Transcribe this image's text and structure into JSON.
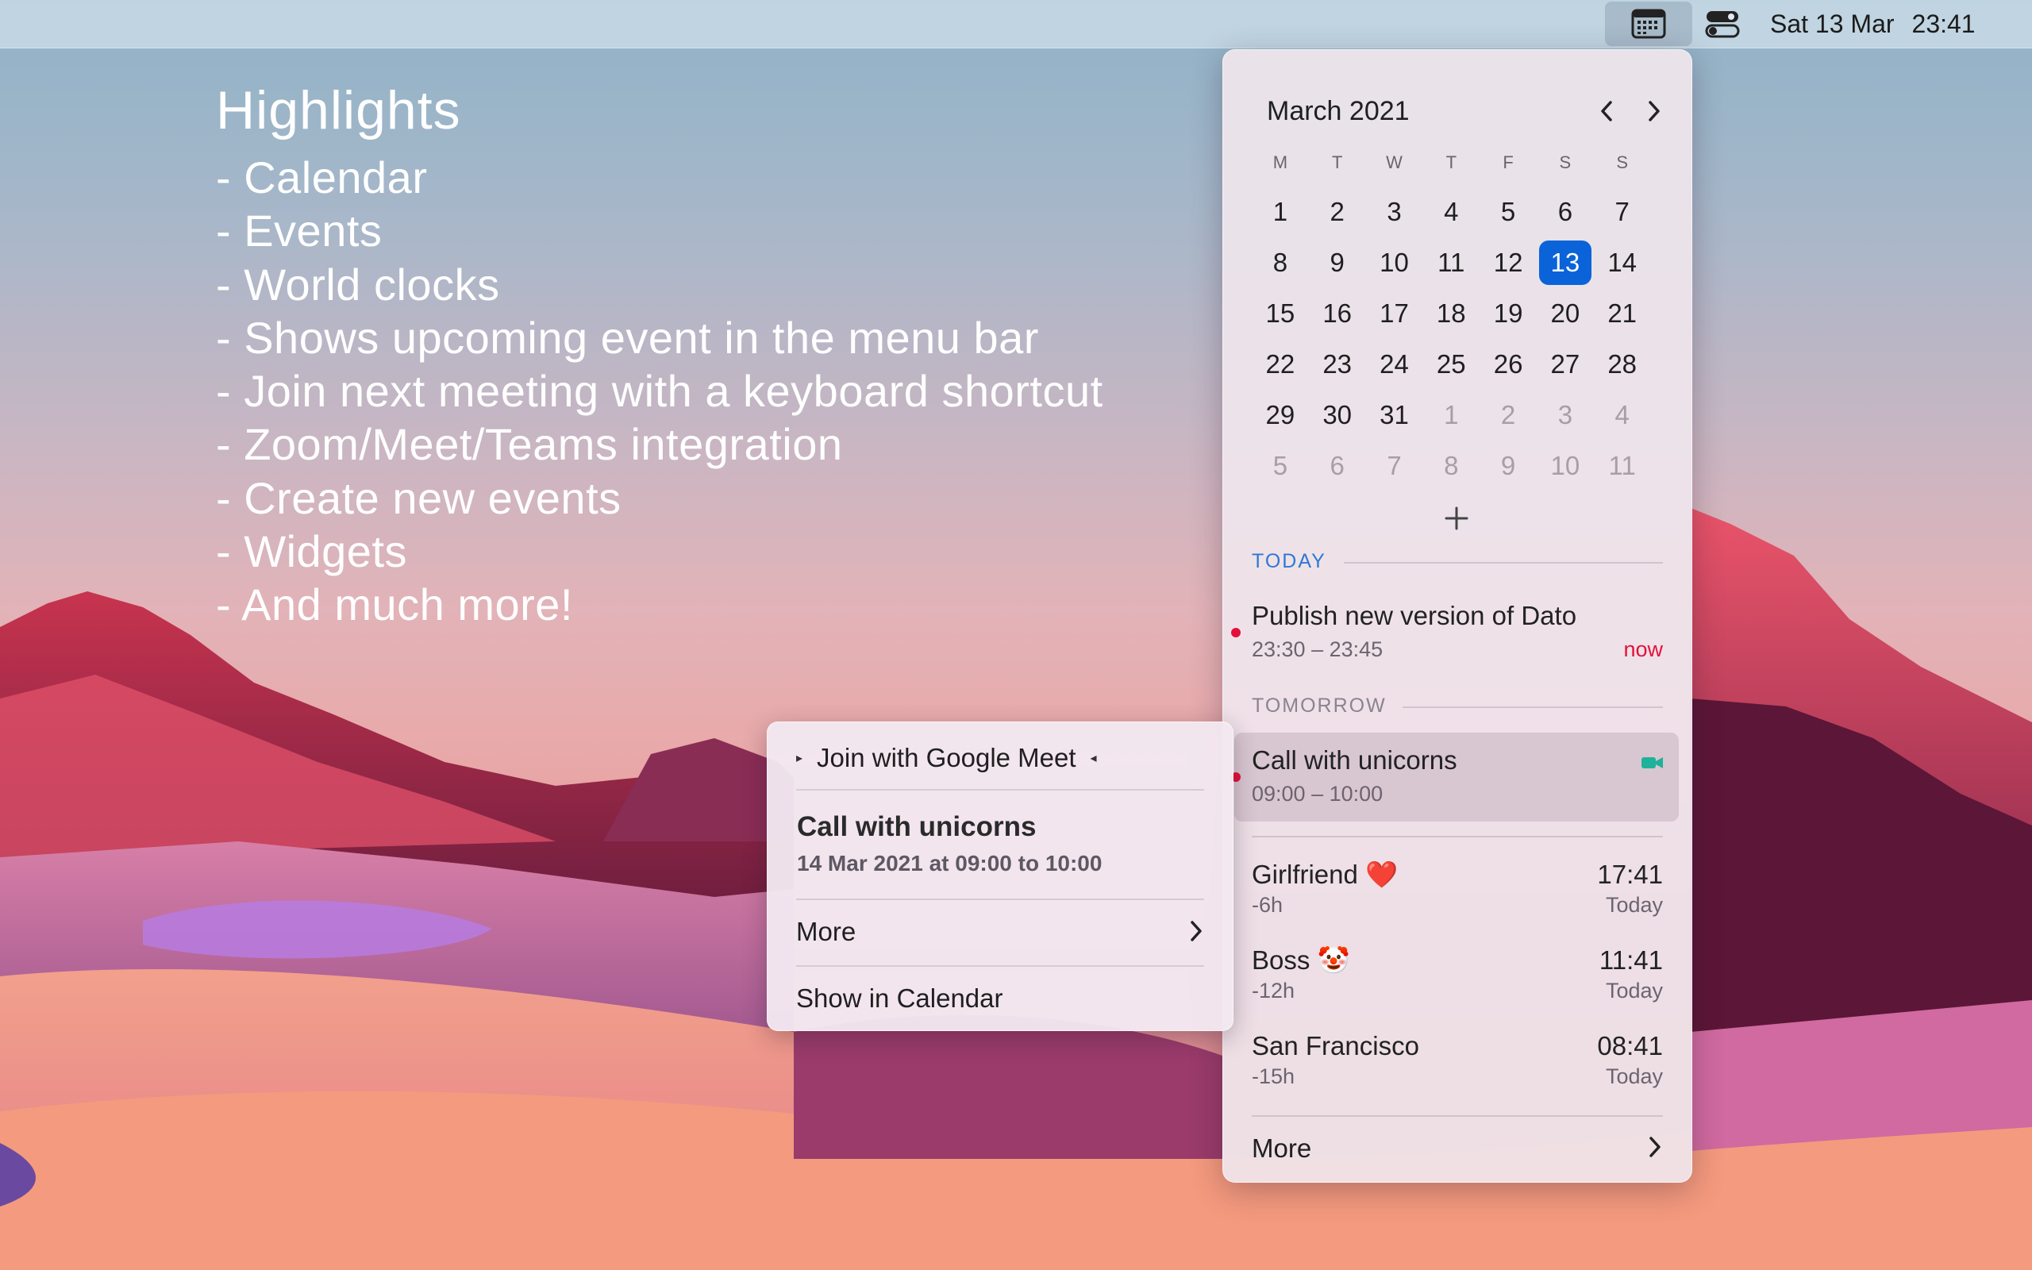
{
  "menubar": {
    "calendar_icon": "calendar-icon",
    "control_center_icon": "control-center-icon",
    "clock_date": "Sat 13 Mar",
    "clock_time": "23:41"
  },
  "highlights": {
    "title": "Highlights",
    "items": [
      "- Calendar",
      "- Events",
      "- World clocks",
      "- Shows upcoming event in the menu bar",
      "- Join next meeting with a keyboard shortcut",
      "- Zoom/Meet/Teams integration",
      "- Create new events",
      "- Widgets",
      "- And much more!"
    ]
  },
  "calendar": {
    "month_title": "March 2021",
    "weekdays": [
      "M",
      "T",
      "W",
      "T",
      "F",
      "S",
      "S"
    ],
    "selected_day": "13",
    "accent_color": "#0a63d8",
    "days": [
      "1",
      "2",
      "3",
      "4",
      "5",
      "6",
      "7",
      "8",
      "9",
      "10",
      "11",
      "12",
      "13",
      "14",
      "15",
      "16",
      "17",
      "18",
      "19",
      "20",
      "21",
      "22",
      "23",
      "24",
      "25",
      "26",
      "27",
      "28",
      "29",
      "30",
      "31",
      "1",
      "2",
      "3",
      "4",
      "5",
      "6",
      "7",
      "8",
      "9",
      "10",
      "11"
    ]
  },
  "today": {
    "label": "TODAY",
    "label_color": "#2f78d4",
    "event": {
      "title": "Publish new version of Dato",
      "time": "23:30 – 23:45",
      "status": "now"
    }
  },
  "tomorrow": {
    "label": "TOMORROW",
    "event": {
      "title": "Call with unicorns",
      "time": "09:00 – 10:00",
      "video_icon": "video-camera-icon"
    }
  },
  "world_clocks": [
    {
      "name": "Girlfriend ❤️",
      "offset": "-6h",
      "time": "17:41",
      "day": "Today"
    },
    {
      "name": "Boss 🤡",
      "offset": "-12h",
      "time": "11:41",
      "day": "Today"
    },
    {
      "name": "San Francisco",
      "offset": "-15h",
      "time": "08:41",
      "day": "Today"
    }
  ],
  "popover_more": "More",
  "context_menu": {
    "join_label": "Join with Google Meet",
    "event_title": "Call with unicorns",
    "event_detail": "14 Mar 2021 at 09:00 to 10:00",
    "more_label": "More",
    "show_in_calendar": "Show in Calendar"
  }
}
